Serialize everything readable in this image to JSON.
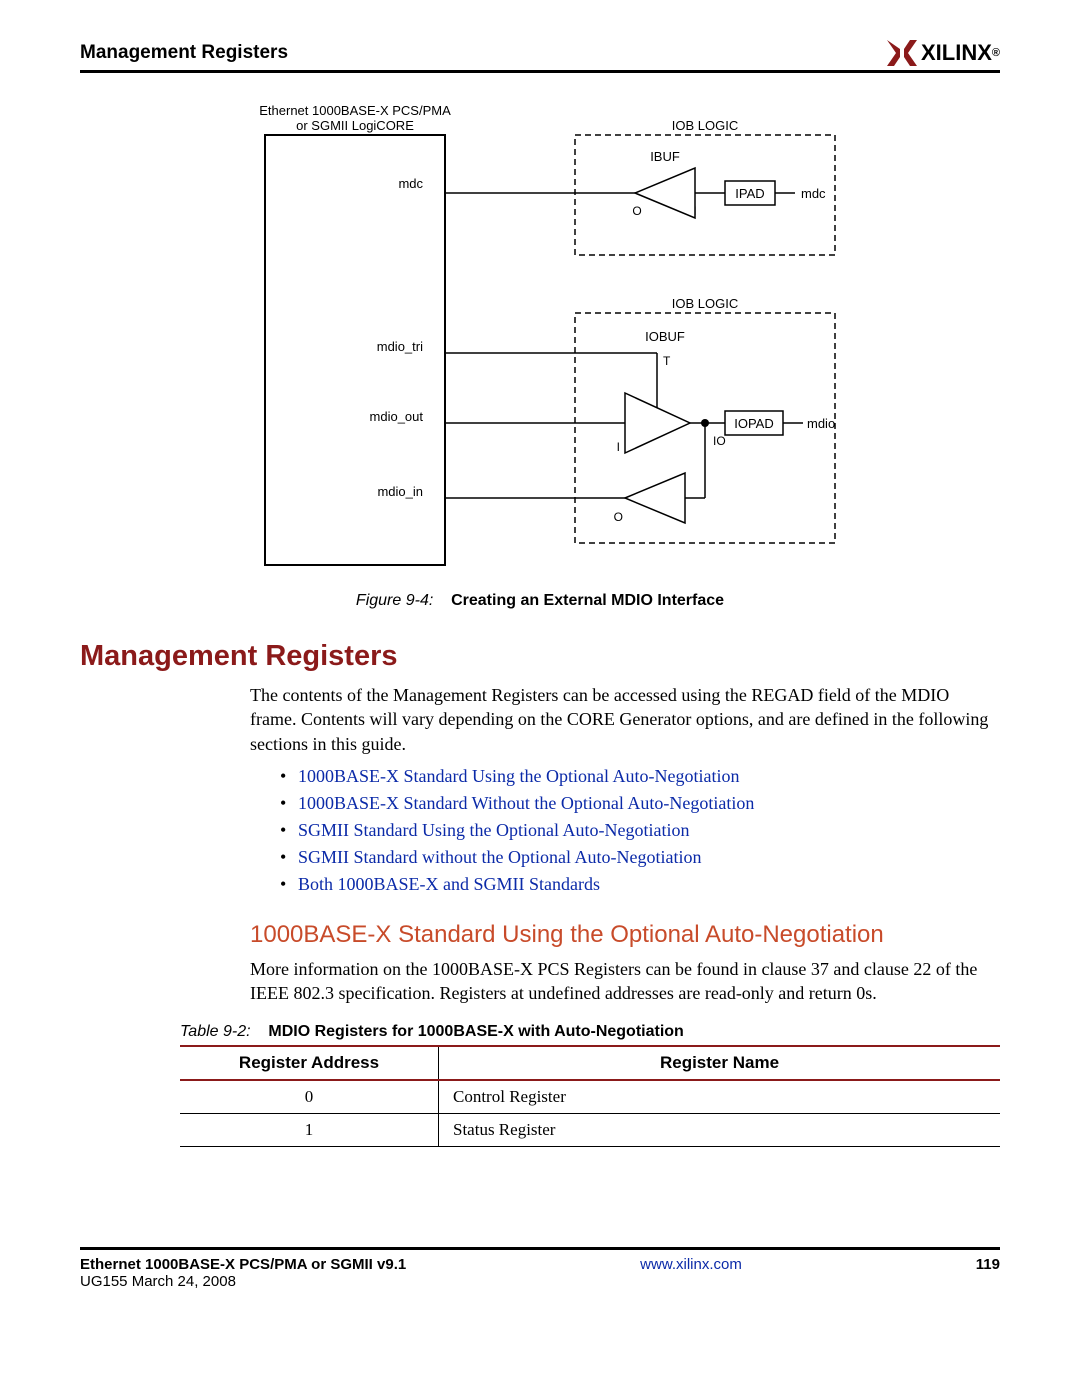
{
  "header": {
    "title": "Management Registers",
    "brand": "XILINX"
  },
  "figure": {
    "block_label_line1": "Ethernet 1000BASE-X PCS/PMA",
    "block_label_line2": "or SGMII LogiCORE",
    "iob_logic": "IOB LOGIC",
    "ibuf": "IBUF",
    "iobuf": "IOBUF",
    "ipad": "IPAD",
    "iopad": "IOPAD",
    "mdc": "mdc",
    "mdio": "mdio",
    "mdio_tri": "mdio_tri",
    "mdio_out": "mdio_out",
    "mdio_in": "mdio_in",
    "O": "O",
    "I": "I",
    "IO": "IO",
    "T": "T",
    "caption_num": "Figure 9-4:",
    "caption_title": "Creating an External MDIO Interface"
  },
  "section1": {
    "heading": "Management Registers",
    "para": "The contents of the Management Registers can be accessed using the REGAD field of the MDIO frame. Contents will vary depending on the CORE Generator options, and are defined in the following sections in this guide.",
    "links": [
      "1000BASE-X Standard Using the Optional Auto-Negotiation",
      "1000BASE-X Standard Without the Optional Auto-Negotiation",
      "SGMII Standard Using the Optional Auto-Negotiation",
      "SGMII Standard without the Optional Auto-Negotiation",
      "Both 1000BASE-X and SGMII Standards"
    ]
  },
  "section2": {
    "heading": "1000BASE-X Standard Using the Optional Auto-Negotiation",
    "para": "More information on the 1000BASE-X PCS Registers can be found in clause 37 and clause 22 of the IEEE 802.3 specification. Registers at undefined addresses are read-only and return 0s."
  },
  "table": {
    "caption_num": "Table 9-2:",
    "caption_title": "MDIO Registers for 1000BASE-X with Auto-Negotiation",
    "headers": [
      "Register Address",
      "Register Name"
    ],
    "rows": [
      {
        "addr": "0",
        "name": "Control Register"
      },
      {
        "addr": "1",
        "name": "Status Register"
      }
    ]
  },
  "footer": {
    "doc": "Ethernet 1000BASE-X PCS/PMA or SGMII v9.1",
    "sub": "UG155 March 24, 2008",
    "url": "www.xilinx.com",
    "page": "119"
  }
}
